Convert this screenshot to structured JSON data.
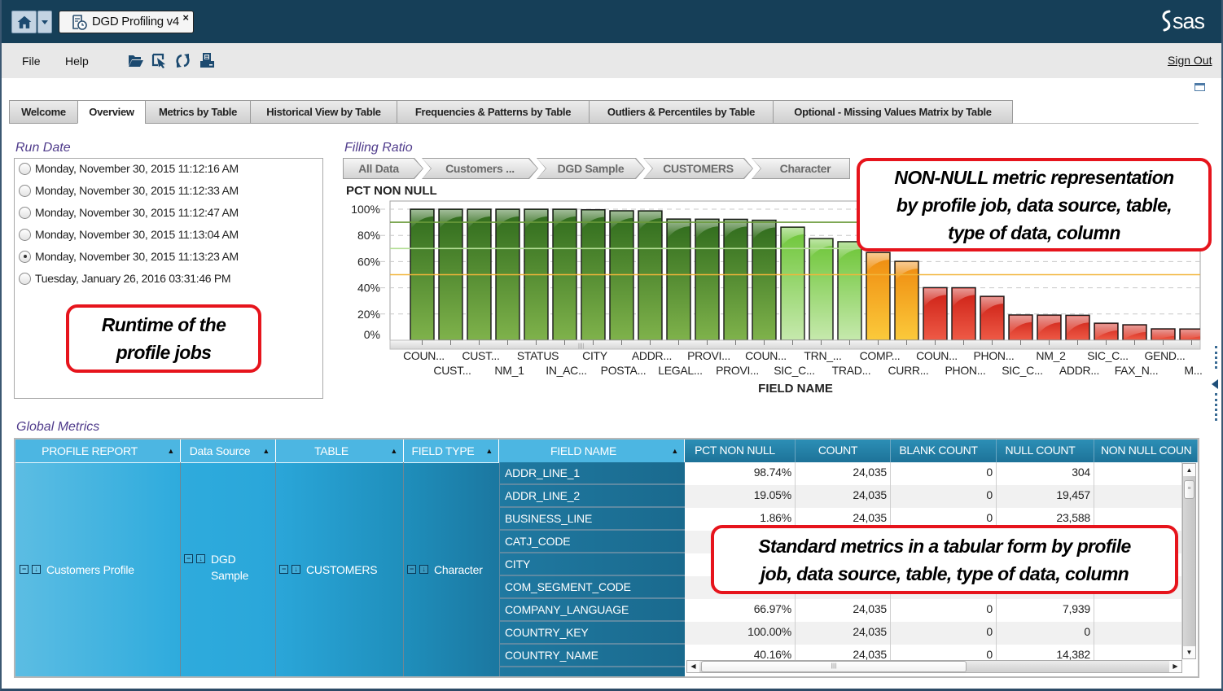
{
  "app": {
    "tab_title": "DGD Profiling v4",
    "tab_close": "×",
    "logo_text": "sas",
    "icons": [
      "home-icon",
      "dropdown-arrow-icon",
      "report-clock-icon",
      "close-icon",
      "sas-logo"
    ]
  },
  "menu": {
    "items": [
      {
        "label": "File"
      },
      {
        "label": "Help"
      }
    ],
    "toolbar": [
      {
        "icon": "open-folder-icon"
      },
      {
        "icon": "edit-select-icon"
      },
      {
        "icon": "refresh-icon"
      },
      {
        "icon": "export-pdf-icon"
      }
    ],
    "sign_out": "Sign Out"
  },
  "tabs": [
    {
      "label": "Welcome",
      "selected": false
    },
    {
      "label": "Overview",
      "selected": true
    },
    {
      "label": "Metrics by Table",
      "selected": false
    },
    {
      "label": "Historical View by Table",
      "selected": false
    },
    {
      "label": "Frequencies & Patterns by Table",
      "selected": false
    },
    {
      "label": "Outliers & Percentiles by Table",
      "selected": false
    },
    {
      "label": "Optional - Missing Values Matrix by Table",
      "selected": false
    }
  ],
  "run_date": {
    "title": "Run Date",
    "options": [
      "Monday, November 30, 2015 11:12:16 AM",
      "Monday, November 30, 2015 11:12:33 AM",
      "Monday, November 30, 2015 11:12:47 AM",
      "Monday, November 30, 2015 11:13:04 AM",
      "Monday, November 30, 2015 11:13:23 AM",
      "Tuesday, January 26, 2016 03:31:46 PM"
    ],
    "selected_index": 4
  },
  "filling_ratio": {
    "title": "Filling Ratio",
    "breadcrumb": [
      "All Data",
      "Customers ...",
      "DGD Sample",
      "CUSTOMERS",
      "Character"
    ]
  },
  "chart_data": {
    "type": "bar",
    "title": "PCT NON NULL",
    "xlabel": "FIELD NAME",
    "ylabel": "",
    "ylim": [
      0,
      100
    ],
    "yticks": [
      0,
      20,
      40,
      60,
      80,
      100
    ],
    "ytick_labels": [
      "0%",
      "20%",
      "40%",
      "60%",
      "80%",
      "100%"
    ],
    "grid": true,
    "legend": "none",
    "categories": [
      "COUN...",
      "CUST...",
      "CUST...",
      "NM_1",
      "STATUS",
      "IN_AC...",
      "CITY",
      "POSTA...",
      "ADDR...",
      "LEGAL...",
      "PROVI...",
      "PROVI...",
      "COUN...",
      "SIC_C...",
      "TRN_...",
      "TRAD...",
      "COMP...",
      "CURR...",
      "COUN...",
      "PHON...",
      "PHON...",
      "SIC_C...",
      "NM_2",
      "ADDR...",
      "SIC_C...",
      "FAX_N...",
      "GEND...",
      "M..."
    ],
    "values": [
      100,
      100,
      100,
      100,
      100,
      100,
      99.6,
      98.8,
      98.74,
      92.5,
      92.4,
      92.3,
      91.6,
      86.3,
      77.6,
      75.2,
      66.97,
      60.2,
      40.16,
      40.1,
      33.5,
      19.3,
      19.2,
      19.05,
      13.0,
      11.8,
      8.7,
      8.6
    ],
    "reference_lines": [
      {
        "value": 90,
        "color": "#6a9a3a"
      },
      {
        "value": 70,
        "color": "#b3de95"
      },
      {
        "value": 50,
        "color": "#f2b53a"
      }
    ],
    "color_bands": [
      {
        "min": 90,
        "top": "#2e6a1c",
        "bottom": "#7fb24b"
      },
      {
        "min": 70,
        "top": "#6cc536",
        "bottom": "#c6e9ad"
      },
      {
        "min": 50,
        "top": "#ef8a0f",
        "bottom": "#fbca3b"
      },
      {
        "min": 0,
        "top": "#cc1e14",
        "bottom": "#ee5a46"
      }
    ]
  },
  "global_metrics": {
    "title": "Global Metrics",
    "group_headers": [
      "PROFILE REPORT",
      "Data Source",
      "TABLE",
      "FIELD TYPE",
      "FIELD NAME"
    ],
    "sort_glyph": "▲",
    "metric_headers": [
      "PCT NON NULL",
      "COUNT",
      "BLANK COUNT",
      "NULL COUNT",
      "NON NULL COUN"
    ],
    "groups": {
      "profile_report": "Customers Profile",
      "data_source_line1": "DGD",
      "data_source_line2": "Sample",
      "table": "CUSTOMERS",
      "field_type": "Character"
    },
    "rows": [
      {
        "field": "ADDR_LINE_1",
        "pct": "98.74%",
        "count": "24,035",
        "blank": "0",
        "null": "304",
        "non_null": ""
      },
      {
        "field": "ADDR_LINE_2",
        "pct": "19.05%",
        "count": "24,035",
        "blank": "0",
        "null": "19,457",
        "non_null": ""
      },
      {
        "field": "BUSINESS_LINE",
        "pct": "1.86%",
        "count": "24,035",
        "blank": "0",
        "null": "23,588",
        "non_null": ""
      },
      {
        "field": "CATJ_CODE",
        "pct": "",
        "count": "",
        "blank": "",
        "null": "",
        "non_null": ""
      },
      {
        "field": "CITY",
        "pct": "",
        "count": "",
        "blank": "",
        "null": "",
        "non_null": ""
      },
      {
        "field": "COM_SEGMENT_CODE",
        "pct": "",
        "count": "",
        "blank": "",
        "null": "",
        "non_null": ""
      },
      {
        "field": "COMPANY_LANGUAGE",
        "pct": "66.97%",
        "count": "24,035",
        "blank": "0",
        "null": "7,939",
        "non_null": ""
      },
      {
        "field": "COUNTRY_KEY",
        "pct": "100.00%",
        "count": "24,035",
        "blank": "0",
        "null": "0",
        "non_null": ""
      },
      {
        "field": "COUNTRY_NAME",
        "pct": "40.16%",
        "count": "24,035",
        "blank": "0",
        "null": "14,382",
        "non_null": ""
      }
    ]
  },
  "annotations": {
    "runtime": [
      "Runtime of the",
      "profile jobs"
    ],
    "non_null": [
      "NON-NULL metric representation",
      "by profile job, data source, table,",
      "type of data, column"
    ],
    "standard": [
      "Standard metrics in a tabular form by profile",
      "job, data source, table, type of data, column"
    ]
  }
}
